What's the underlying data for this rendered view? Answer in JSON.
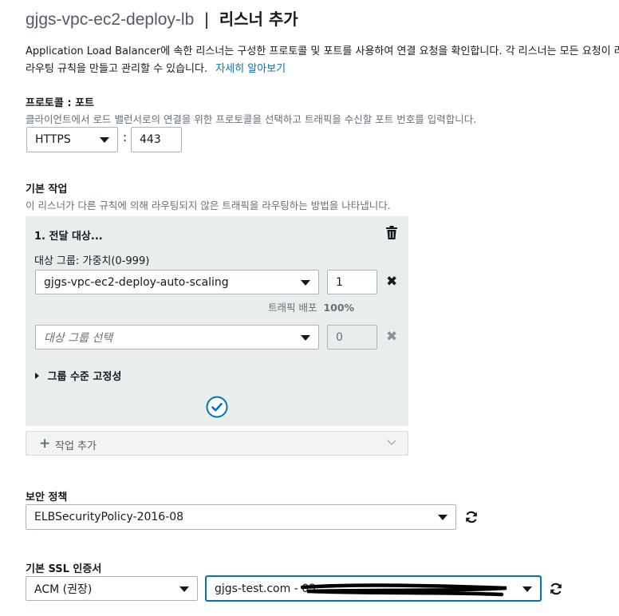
{
  "header": {
    "lb_name": "gjgs-vpc-ec2-deploy-lb",
    "separator": "|",
    "page_title": "리스너 추가"
  },
  "intro": {
    "line1": "Application Load Balancer에 속한 리스너는 구성한 프로토콜 및 포트를 사용하여 연결 요청을 확인합니다. 각 리스너는 모든 요청이 라",
    "line2": "라우팅 규칙을 만들고 관리할 수 있습니다.",
    "learn_more": "자세히 알아보기"
  },
  "protocol_port": {
    "label": "프로토콜 : 포트",
    "hint": "클라이언트에서 로드 밸런서로의 연결을 위한 프로토콜을 선택하고 트래픽을 수신할 포트 번호를 입력합니다.",
    "protocol": "HTTPS",
    "colon": ":",
    "port": "443"
  },
  "default_action": {
    "label": "기본 작업",
    "hint": "이 리스너가 다른 규칙에 의해 라우팅되지 않은 트래픽을 라우팅하는 방법을 나타냅니다.",
    "action_title": "1. 전달 대상...",
    "target_group_label": "대상 그룹: 가중치(0-999)",
    "target_groups": [
      {
        "name": "gjgs-vpc-ec2-deploy-auto-scaling",
        "weight": "1"
      },
      {
        "name": "대상 그룹 선택",
        "weight": "0"
      }
    ],
    "traffic_label": "트래픽 배포",
    "traffic_value": "100%",
    "stickiness": "그룹 수준 고정성",
    "add_action": "작업 추가"
  },
  "security_policy": {
    "label": "보안 정책",
    "value": "ELBSecurityPolicy-2016-08"
  },
  "ssl_cert": {
    "label": "기본 SSL 인증서",
    "source": "ACM (권장)",
    "certificate": "gjgs-test.com - 03"
  },
  "icons": [
    "trash-icon",
    "close-icon",
    "check-circle-icon",
    "caret-right-icon",
    "plus-icon",
    "chevron-down-icon",
    "refresh-icon"
  ],
  "colors": {
    "accent": "#0073bb",
    "panel_bg": "#eaeded",
    "muted_text": "#687078"
  }
}
